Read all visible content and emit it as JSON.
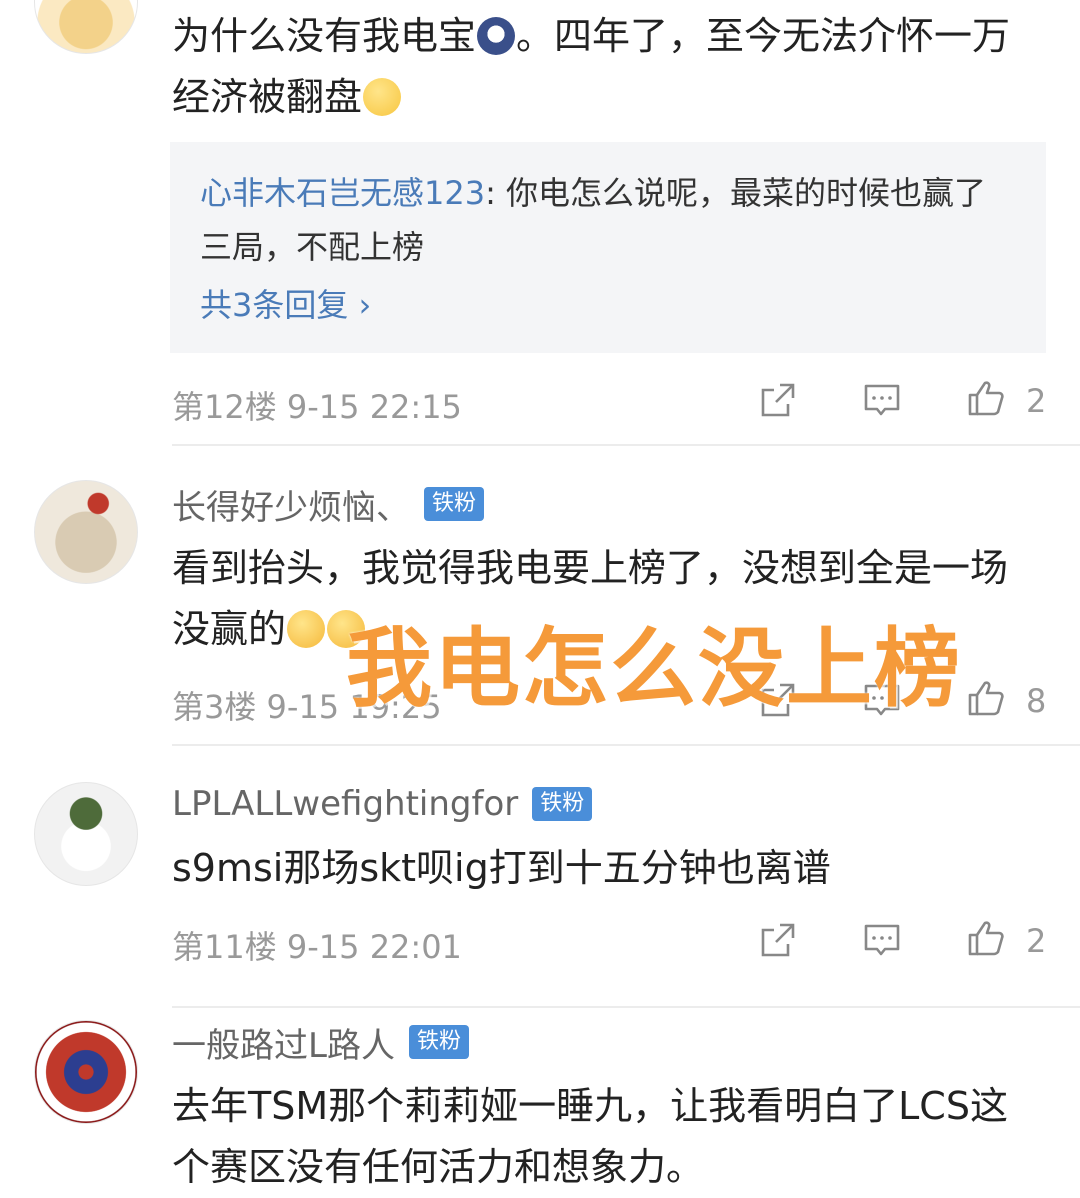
{
  "comments": [
    {
      "text_a": "为什么没有我电宝",
      "text_b": "。四年了，至今无法介怀一万经济被翻盘",
      "reply": {
        "author": "心非木石岂无感123",
        "text": ": 你电怎么说呢，最菜的时候也赢了三局，不配上榜",
        "more": "共3条回复 ›"
      },
      "meta": "第12楼  9-15 22:15",
      "likes": "2"
    },
    {
      "author": "长得好少烦恼、",
      "badge": "铁粉",
      "text": "看到抬头，我觉得我电要上榜了，没想到全是一场没赢的",
      "meta": "第3楼  9-15 19:25",
      "likes": "8"
    },
    {
      "author": "LPLALLwefightingfor",
      "badge": "铁粉",
      "text": "s9msi那场skt呗ig打到十五分钟也离谱",
      "meta": "第11楼  9-15 22:01",
      "likes": "2"
    },
    {
      "author": "一般路过L路人",
      "badge": "铁粉",
      "text": "去年TSM那个莉莉娅一睡九，让我看明白了LCS这个赛区没有任何活力和想象力。"
    }
  ],
  "overlay": "我电怎么没上榜",
  "colors": {
    "link": "#4a7bb8",
    "badge": "#4a8ed9",
    "overlay": "#f59a3a",
    "meta": "#999999"
  },
  "icons": [
    "share-icon",
    "comment-icon",
    "thumbs-up-icon"
  ]
}
